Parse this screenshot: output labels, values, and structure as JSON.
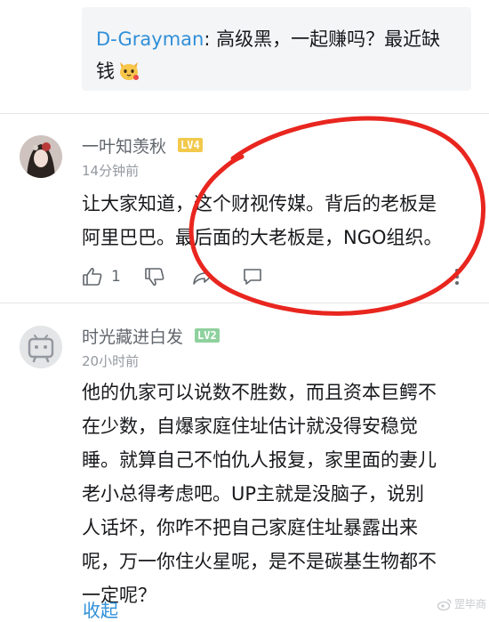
{
  "reply_preview": {
    "author": "D-Grayman",
    "text_line1": ": 高级黑，一起赚吗？最近缺",
    "text_line2": "钱"
  },
  "comment1": {
    "username": "一叶知羡秋",
    "level": "LV4",
    "level_color": "#f2c94c",
    "time": "14分钟前",
    "line1": "让大家知道，这个财视传媒。背后的老板是",
    "line2": "阿里巴巴。最后面的大老板是，NGO组织。",
    "like_count": "1"
  },
  "comment2": {
    "username": "时光藏进白发",
    "level": "LV2",
    "level_color": "#8fd19e",
    "time": "20小时前",
    "lines": [
      "他的仇家可以说数不胜数，而且资本巨鳄不",
      "在少数，自爆家庭住址估计就没得安稳觉",
      "睡。就算自己不怕仇人报复，家里面的妻儿",
      "老小总得考虑吧。UP主就是没脑子，说别",
      "人话坏，你咋不把自己家庭住址暴露出来",
      "呢，万一你住火星呢，是不是碳基生物都不",
      "一定呢？"
    ],
    "collapse_label": "收起"
  },
  "watermark": "罡毕商",
  "colors": {
    "link_blue": "#2f8fd8",
    "annotation_red": "#e8261f"
  }
}
